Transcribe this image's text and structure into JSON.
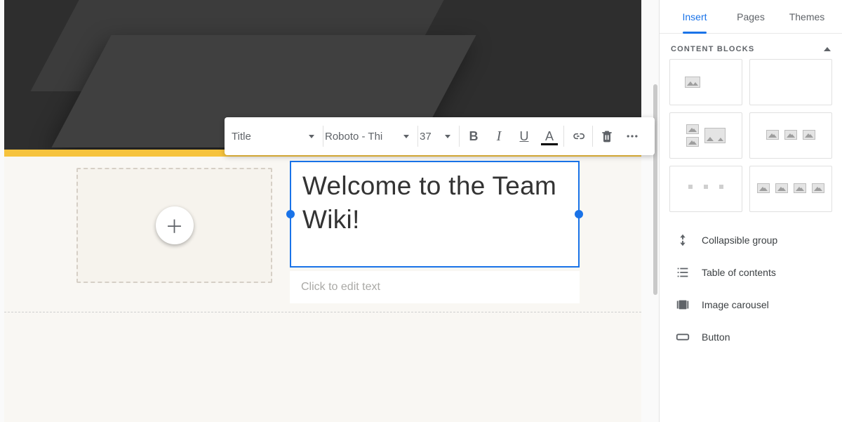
{
  "toolbar": {
    "style_label": "Title",
    "font_label": "Roboto - Thi",
    "size_label": "37"
  },
  "editor": {
    "title_text": "Welcome to the Team Wiki!",
    "subtitle_placeholder": "Click to edit text"
  },
  "sidebar": {
    "tabs": {
      "insert": "Insert",
      "pages": "Pages",
      "themes": "Themes"
    },
    "section_label": "CONTENT BLOCKS",
    "widgets": {
      "collapsible": "Collapsible group",
      "toc": "Table of contents",
      "carousel": "Image carousel",
      "button": "Button"
    }
  }
}
